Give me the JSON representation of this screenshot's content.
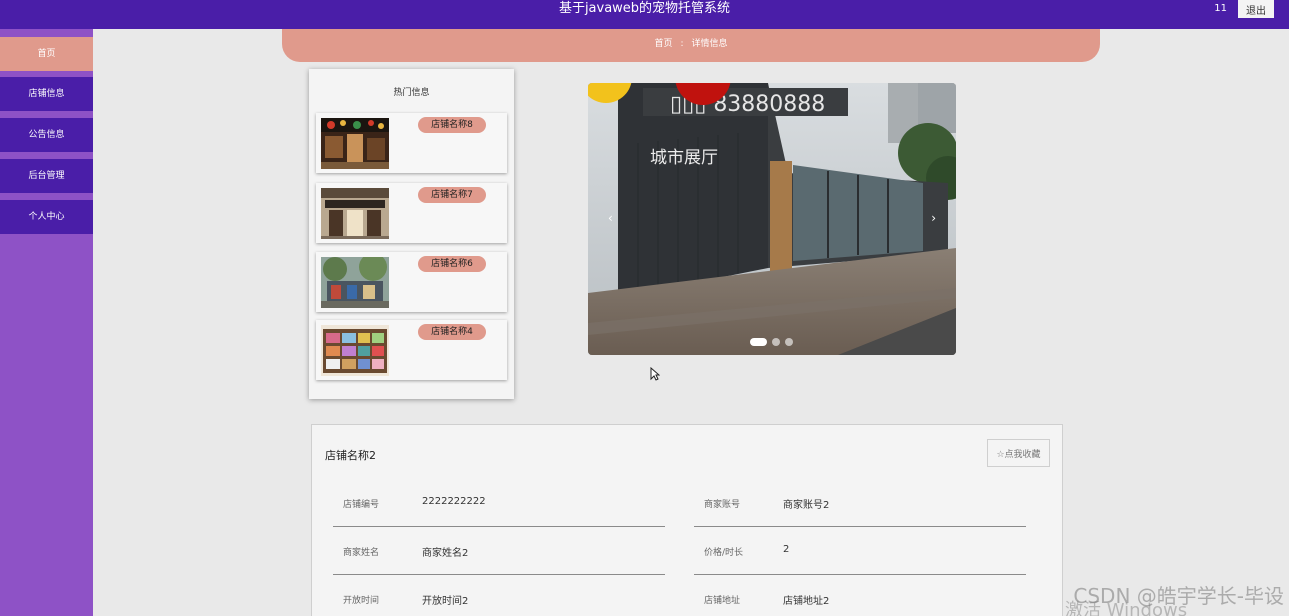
{
  "header": {
    "title": "基于javaweb的宠物托管系统",
    "user": "11",
    "logout_label": "退出",
    "bg": "#4a1ea8"
  },
  "sidebar": {
    "items": [
      {
        "label": "首页",
        "active": true
      },
      {
        "label": "店铺信息"
      },
      {
        "label": "公告信息"
      },
      {
        "label": "后台管理"
      },
      {
        "label": "个人中心"
      }
    ]
  },
  "breadcrumb": {
    "home": "首页",
    "separator": ":",
    "current": "详情信息"
  },
  "hot": {
    "title": "热门信息",
    "items": [
      {
        "name": "店铺名称8",
        "thumb": "storefront-photo-1"
      },
      {
        "name": "店铺名称7",
        "thumb": "storefront-photo-2"
      },
      {
        "name": "店铺名称6",
        "thumb": "storefront-photo-3"
      },
      {
        "name": "店铺名称4",
        "thumb": "storefront-photo-4"
      }
    ]
  },
  "carousel": {
    "image": "container-showroom-photo",
    "sign_text": "城市展厅",
    "prev_icon": "‹",
    "next_icon": "›",
    "slides": 3,
    "active_slide": 0
  },
  "detail": {
    "title": "店铺名称2",
    "favorite_label": "☆点我收藏",
    "fields": [
      {
        "label": "店铺编号",
        "value": "2222222222"
      },
      {
        "label": "商家账号",
        "value": "商家账号2"
      },
      {
        "label": "商家姓名",
        "value": "商家姓名2"
      },
      {
        "label": "价格/时长",
        "value": "2"
      },
      {
        "label": "开放时间",
        "value": "开放时间2"
      },
      {
        "label": "店铺地址",
        "value": "店铺地址2"
      }
    ]
  },
  "watermarks": {
    "csdn": "CSDN @皓宇学长-毕设",
    "windows": "激活 Windows"
  },
  "colors": {
    "accent_salmon": "#e09a8c",
    "sidebar_purple": "#8e52c6",
    "nav_dark": "#4a1ea8"
  }
}
